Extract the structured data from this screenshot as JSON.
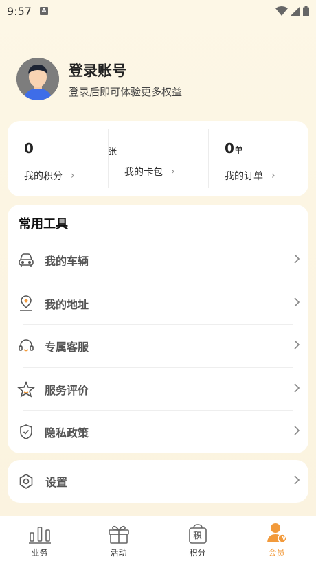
{
  "status_bar": {
    "time": "9:57",
    "notif_icon": "A"
  },
  "profile": {
    "title": "登录账号",
    "subtitle": "登录后即可体验更多权益"
  },
  "stats": [
    {
      "value": "0",
      "unit": "",
      "label": "我的积分"
    },
    {
      "value": "",
      "unit": "张",
      "label": "我的卡包"
    },
    {
      "value": "0",
      "unit": "单",
      "label": "我的订单"
    }
  ],
  "tools": {
    "title": "常用工具",
    "items": [
      {
        "label": "我的车辆",
        "icon": "car-icon"
      },
      {
        "label": "我的地址",
        "icon": "location-icon"
      },
      {
        "label": "专属客服",
        "icon": "headset-icon"
      },
      {
        "label": "服务评价",
        "icon": "star-icon"
      },
      {
        "label": "隐私政策",
        "icon": "shield-icon"
      }
    ]
  },
  "settings": {
    "label": "设置",
    "icon": "gear-icon"
  },
  "tabbar": [
    {
      "label": "业务",
      "icon": "bar-chart-icon",
      "active": false
    },
    {
      "label": "活动",
      "icon": "gift-icon",
      "active": false
    },
    {
      "label": "积分",
      "icon": "points-bag-icon",
      "glyph": "积",
      "active": false
    },
    {
      "label": "会员",
      "icon": "member-icon",
      "badge": "V",
      "active": true
    }
  ],
  "colors": {
    "accent": "#f29a3b",
    "background": "#fdf7e6"
  }
}
